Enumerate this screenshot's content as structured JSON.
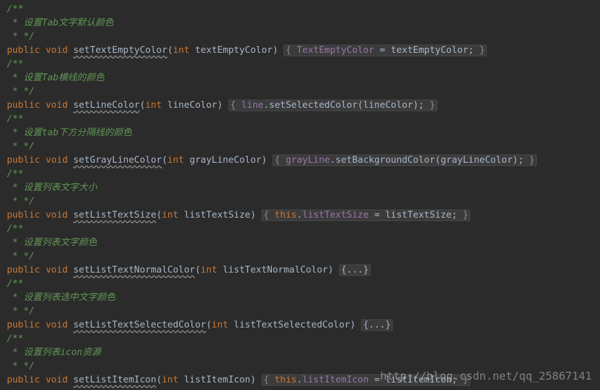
{
  "editor": {
    "blocks": [
      {
        "open": "/**",
        "comment_prefix": " * ",
        "comment_text": "设置",
        "comment_tag": "Tab",
        "comment_text2": "文字默认颜色",
        "close": " * */",
        "kw1": "public",
        "kw2": "void",
        "method": "setTextEmptyColor",
        "param_type": "int",
        "param_name": "textEmptyColor",
        "body_pre": "{ ",
        "body_field": "TextEmptyColor",
        "body_mid": " = textEmptyColor; ",
        "body_post": "}"
      },
      {
        "open": "/**",
        "comment_prefix": " * ",
        "comment_text": "设置",
        "comment_tag": "Tab",
        "comment_text2": "横线的颜色",
        "close": " * */",
        "kw1": "public",
        "kw2": "void",
        "method": "setLineColor",
        "param_type": "int",
        "param_name": "lineColor",
        "body_pre": "{ ",
        "body_field": "line",
        "body_mid": ".setSelectedColor(lineColor); ",
        "body_post": "}"
      },
      {
        "open": "/**",
        "comment_prefix": " * ",
        "comment_text": "设置",
        "comment_tag": "tab",
        "comment_text2": "下方分隔线的颜色",
        "close": " * */",
        "kw1": "public",
        "kw2": "void",
        "method": "setGrayLineColor",
        "param_type": "int",
        "param_name": "grayLineColor",
        "body_pre": "{ ",
        "body_field": "grayLine",
        "body_mid": ".setBackgroundColor(grayLineColor); ",
        "body_post": "}"
      },
      {
        "open": "/**",
        "comment_prefix": " * ",
        "comment_text": "设置列表文字大小",
        "comment_tag": "",
        "comment_text2": "",
        "close": " * */",
        "kw1": "public",
        "kw2": "void",
        "method": "setListTextSize",
        "param_type": "int",
        "param_name": "listTextSize",
        "body_pre": "{ ",
        "body_kw": "this",
        "body_dot": ".",
        "body_field": "listTextSize",
        "body_mid": " = listTextSize; ",
        "body_post": "}"
      },
      {
        "open": "/**",
        "comment_prefix": " * ",
        "comment_text": "设置列表文字颜色",
        "comment_tag": "",
        "comment_text2": "",
        "close": " * */",
        "kw1": "public",
        "kw2": "void",
        "method": "setListTextNormalColor",
        "param_type": "int",
        "param_name": "listTextNormalColor",
        "folded": "{...}"
      },
      {
        "open": "/**",
        "comment_prefix": " * ",
        "comment_text": "设置列表选中文字颜色",
        "comment_tag": "",
        "comment_text2": "",
        "close": " * */",
        "kw1": "public",
        "kw2": "void",
        "method": "setListTextSelectedColor",
        "param_type": "int",
        "param_name": "listTextSelectedColor",
        "folded": "{...}"
      },
      {
        "open": "/**",
        "comment_prefix": " * ",
        "comment_text": "设置列表",
        "comment_tag": "icon",
        "comment_text2": "资源",
        "close": " * */",
        "kw1": "public",
        "kw2": "void",
        "method": "setListItemIcon",
        "param_type": "int",
        "param_name": "listItemIcon",
        "body_pre": "{ ",
        "body_kw": "this",
        "body_dot": ".",
        "body_field": "listItemIcon",
        "body_mid": " = listItemIcon; ",
        "body_post": "}"
      }
    ]
  },
  "watermark": "http://blog.csdn.net/qq_25867141",
  "colors": {
    "background": "#2b2b2b",
    "keyword": "#cc7832",
    "comment": "#629755",
    "field": "#9876aa",
    "text": "#a9b7c6"
  }
}
